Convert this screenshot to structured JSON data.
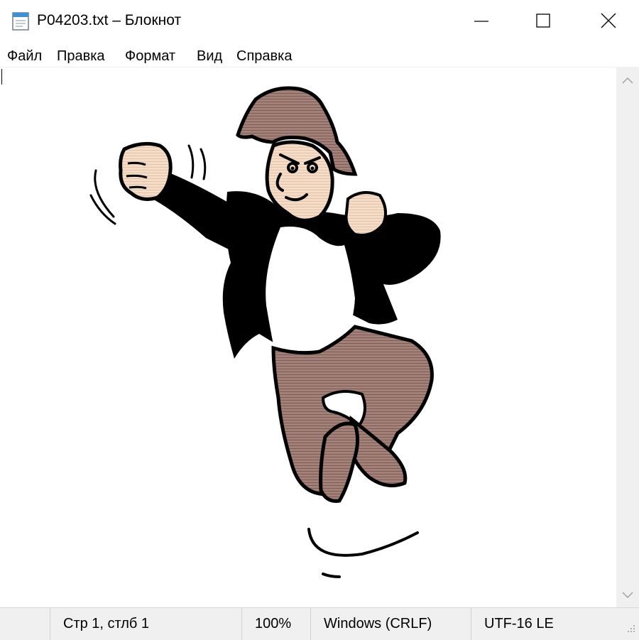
{
  "window": {
    "title": "P04203.txt – Блокнот",
    "app_icon": "notepad-icon",
    "controls": [
      "minimize-icon",
      "maximize-icon",
      "close-icon"
    ]
  },
  "menu": {
    "items": [
      "Файл",
      "Правка",
      "Формат",
      "Вид",
      "Справка"
    ]
  },
  "editor": {
    "content": "ASCII-art cartoon: angry man jumping with raised fist, black jacket, brown hair and trousers",
    "colors": {
      "hair": "#9b7b72",
      "skin": "#f3d9c2",
      "pants": "#9b7b72",
      "jacket": "#000000"
    }
  },
  "scrollbar": {
    "up_icon": "chevron-up-icon",
    "down_icon": "chevron-down-icon"
  },
  "status": {
    "position": "Стр 1, стлб 1",
    "zoom": "100%",
    "line_endings": "Windows (CRLF)",
    "encoding": "UTF-16 LE"
  }
}
